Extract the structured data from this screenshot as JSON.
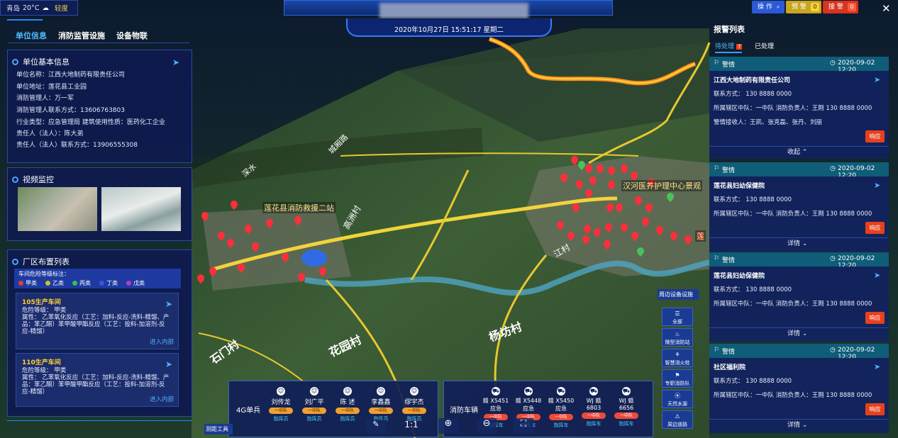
{
  "weather": {
    "city": "青岛",
    "temp": "20°C",
    "quality": "轻度"
  },
  "header": {
    "datetime": "2020年10月27日 15:51:17 星期二"
  },
  "left_tabs": [
    "单位信息",
    "消防监管设施",
    "设备物联"
  ],
  "unit": {
    "title": "单位基本信息",
    "lines": [
      "单位名称：江西大地制药有限责任公司",
      "单位地址：莲花县工业园",
      "消防管理人：万一军",
      "消防管理人联系方式：13606763803",
      "行业类型：应急管理局      建筑使用性质：医药化工企业",
      "责任人（法人）：陈大弟",
      "责任人（法人）联系方式：13906555308"
    ]
  },
  "video": {
    "title": "视频监控"
  },
  "plant": {
    "title": "厂区布置列表",
    "legend_title": "车间危险等级标注：",
    "legend": [
      {
        "label": "甲类",
        "color": "#e23b3b"
      },
      {
        "label": "乙类",
        "color": "#c9c22a"
      },
      {
        "label": "丙类",
        "color": "#34c24a"
      },
      {
        "label": "丁类",
        "color": "#3a55e0"
      },
      {
        "label": "戊类",
        "color": "#b23cc8"
      }
    ],
    "cards": [
      {
        "name": "105生产车间",
        "level": "危险等级：    甲类",
        "attr": "属性：  乙苯氧化反应（工艺：加料-反应-洗料-精馏、产品：苯乙酮）苯甲酸甲酯反应（工艺：投料-加溶剂-反应-精馏）",
        "enter": "进入内部"
      },
      {
        "name": "110生产车间",
        "level": "危险等级：    甲类",
        "attr": "属性：  乙苯氧化反应（工艺：加料-反应-洗料-精馏、产品：苯乙酮）苯甲酸甲酯反应（工艺：投料-加溶剂-反应-精馏）",
        "enter": "进入内部"
      }
    ]
  },
  "topright": {
    "op": "操 作",
    "warn": "预 警",
    "warn_n": "0",
    "alarm": "接 警",
    "alarm_n": "0"
  },
  "alarms": {
    "title": "报警列表",
    "tab_pending": "待处理",
    "pending_n": "7",
    "tab_done": "已处理",
    "items": [
      {
        "type": "警情",
        "time": "2020-09-02 12:20",
        "name": "江西大地制药有限责任公司",
        "contact": "联系方式：  130 8888 0000",
        "area": "所属辖区中队：一中队    消防负责人：王刚    130 8888 0000",
        "recv": "警情接收人：王凯、张克磊、张丹、刘丽",
        "btn": "响应",
        "fold": "收起"
      },
      {
        "type": "警情",
        "time": "2020-09-02 12:20",
        "name": "莲花县妇幼保健院",
        "contact": "联系方式：  130 8888 0000",
        "area": "所属辖区中队：一中队    消防负责人：王刚    130 8888 0000",
        "btn": "响应",
        "fold": "详情"
      },
      {
        "type": "警情",
        "time": "2020-09-02 12:20",
        "name": "莲花县妇幼保健院",
        "contact": "联系方式：  130 8888 0000",
        "area": "所属辖区中队：一中队    消防负责人：王刚    130 8888 0000",
        "btn": "响应",
        "fold": "详情"
      },
      {
        "type": "警情",
        "time": "2020-09-02 12:20",
        "name": "社区福利院",
        "contact": "联系方式：  130 8888 0000",
        "area": "所属辖区中队：一中队    消防负责人：王刚    130 8888 0000",
        "btn": "响应",
        "fold": "详情"
      }
    ]
  },
  "map_labels": {
    "station": "莲花县消防救援二站",
    "center": "汉河医养护理中心景观",
    "place": "莲",
    "v1": "花园村",
    "v2": "杨坊村",
    "v3": "石门村",
    "v4": "江村",
    "v5": "高洲村",
    "r1": "城厢路",
    "r2": "深水"
  },
  "soldiers": {
    "title": "4G单兵",
    "people": [
      {
        "name": "刘传龙",
        "tag": "一中队",
        "role": "指挥员"
      },
      {
        "name": "刘广平",
        "tag": "一中队",
        "role": "指挥员"
      },
      {
        "name": "陈 述",
        "tag": "一中队",
        "role": "指挥员"
      },
      {
        "name": "李鑫鑫",
        "tag": "一中队",
        "role": "指挥员"
      },
      {
        "name": "缪宇杰",
        "tag": "一中队",
        "role": "指挥员"
      }
    ]
  },
  "vehicles": {
    "title": "消防车辆",
    "items": [
      {
        "plate": "赣 X5451",
        "kind": "应急",
        "tag": "一中队",
        "role": "指挥车"
      },
      {
        "plate": "赣 X5448",
        "kind": "应急",
        "tag": "一中队",
        "role": "指挥车"
      },
      {
        "plate": "赣 X5450",
        "kind": "应急",
        "tag": "一中队",
        "role": "指挥车"
      },
      {
        "plate": "WJ 赣",
        "kind": "6803",
        "tag": "一中队",
        "role": "指挥车"
      },
      {
        "plate": "WJ 赣",
        "kind": "6656",
        "tag": "一中队",
        "role": "指挥车"
      }
    ]
  },
  "side": {
    "title": "周边设备设施",
    "items": [
      "全部",
      "微型消防站",
      "智慧消火栓",
      "专职消防队",
      "天然水源",
      "周边道路"
    ]
  },
  "bottom_tools": {
    "measure": "测距工具",
    "scale": "1:1"
  }
}
